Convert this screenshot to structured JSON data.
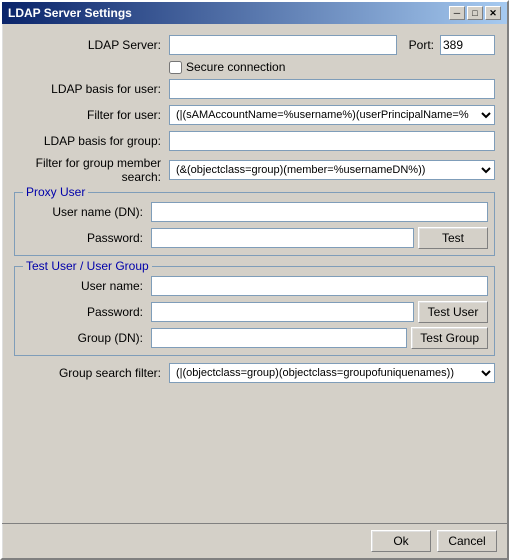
{
  "window": {
    "title": "LDAP Server Settings",
    "close_btn": "✕",
    "maximize_btn": "□",
    "minimize_btn": "─"
  },
  "form": {
    "ldap_server_label": "LDAP Server:",
    "ldap_server_value": "",
    "port_label": "Port:",
    "port_value": "389",
    "secure_label": "Secure connection",
    "ldap_basis_user_label": "LDAP basis for user:",
    "ldap_basis_user_value": "",
    "filter_user_label": "Filter for user:",
    "filter_user_value": "(|(sAMAccountName=%username%)(userPrincipalName=%",
    "ldap_basis_group_label": "LDAP basis for group:",
    "ldap_basis_group_value": "",
    "filter_group_label": "Filter for group member search:",
    "filter_group_value": "(&(objectclass=group)(member=%usernameDN%))",
    "group_search_label": "Group search filter:",
    "group_search_value": "(|(objectclass=group)(objectclass=groupofuniquenames))"
  },
  "proxy_user": {
    "section_title": "Proxy User",
    "username_label": "User name (DN):",
    "username_value": "",
    "password_label": "Password:",
    "password_value": "",
    "test_btn": "Test"
  },
  "test_section": {
    "section_title": "Test User / User Group",
    "username_label": "User name:",
    "username_value": "",
    "password_label": "Password:",
    "password_value": "",
    "test_user_btn": "Test User",
    "group_label": "Group (DN):",
    "group_value": "",
    "test_group_btn": "Test Group"
  },
  "bottom": {
    "ok_btn": "Ok",
    "cancel_btn": "Cancel"
  }
}
